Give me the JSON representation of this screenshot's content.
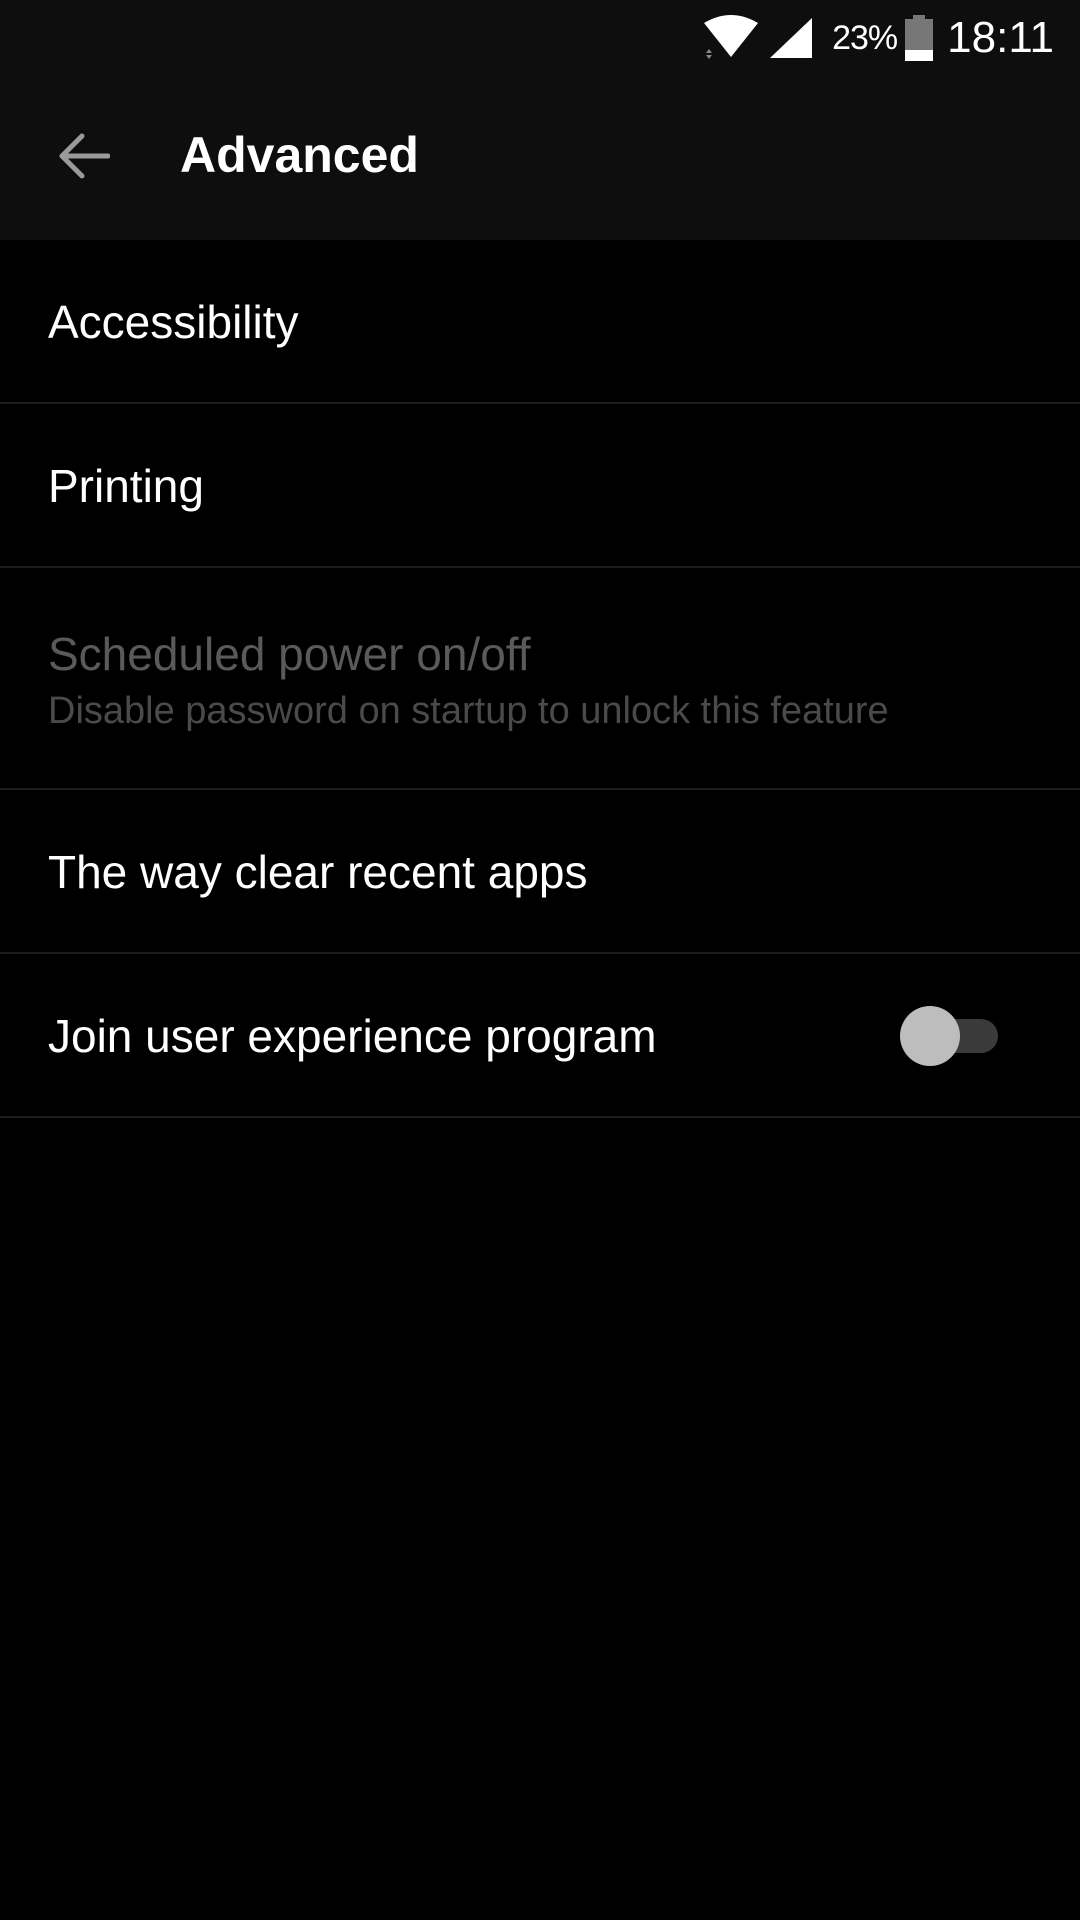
{
  "status_bar": {
    "battery_percent": "23%",
    "time": "18:11",
    "icons": [
      "wifi-icon",
      "cell-signal-icon",
      "battery-icon"
    ]
  },
  "app_bar": {
    "title": "Advanced",
    "back_icon": "arrow-back-icon"
  },
  "items": [
    {
      "label": "Accessibility",
      "enabled": true
    },
    {
      "label": "Printing",
      "enabled": true
    },
    {
      "label": "Scheduled power on/off",
      "sublabel": "Disable password on startup to unlock this feature",
      "enabled": false
    },
    {
      "label": "The way clear recent apps",
      "enabled": true
    },
    {
      "label": "Join user experience program",
      "enabled": true,
      "toggle_on": false
    }
  ],
  "colors": {
    "background": "#000000",
    "bar_background": "#0e0e0e",
    "divider": "#1c1c1c",
    "text_primary": "#ffffff",
    "text_disabled": "#5a5a5a",
    "toggle_thumb": "#bdbdbd",
    "toggle_track": "#3a3a3a"
  }
}
